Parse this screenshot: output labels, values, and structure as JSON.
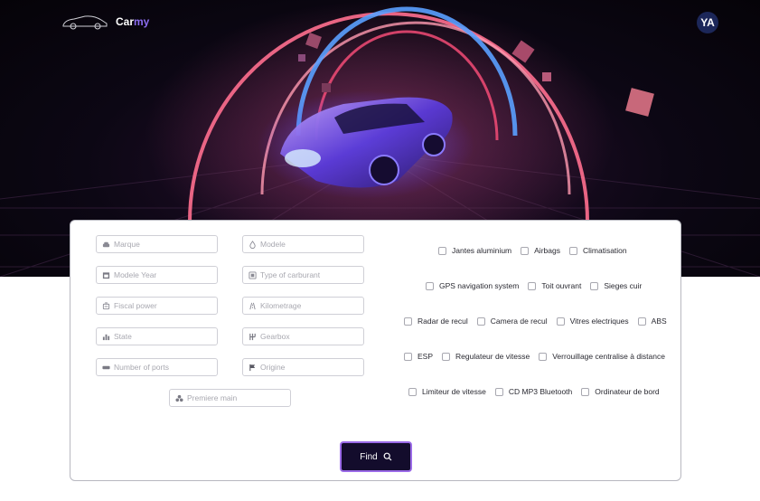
{
  "brand": {
    "name_main": "Car",
    "name_accent": "my"
  },
  "user": {
    "initials": "YA"
  },
  "colors": {
    "accent": "#8b6cf0",
    "button_bg": "#130c2c",
    "button_border": "#9b6be8",
    "avatar_bg": "#1c2759"
  },
  "hero": {
    "image": "neon-sports-car-illustration"
  },
  "search": {
    "fields": [
      {
        "placeholder": "Marque",
        "icon": "car-icon"
      },
      {
        "placeholder": "Modele",
        "icon": "drop-icon"
      },
      {
        "placeholder": "Modele Year",
        "icon": "calendar-icon"
      },
      {
        "placeholder": "Type of carburant",
        "icon": "fuel-icon"
      },
      {
        "placeholder": "Fiscal power",
        "icon": "engine-icon"
      },
      {
        "placeholder": "Kilometrage",
        "icon": "road-icon"
      },
      {
        "placeholder": "State",
        "icon": "bars-icon"
      },
      {
        "placeholder": "Gearbox",
        "icon": "gearbox-icon"
      },
      {
        "placeholder": "Number of ports",
        "icon": "door-icon"
      },
      {
        "placeholder": "Origine",
        "icon": "flag-icon"
      },
      {
        "placeholder": "Premiere main",
        "icon": "users-icon"
      }
    ],
    "options": [
      "Jantes aluminium",
      "Airbags",
      "Climatisation",
      "GPS navigation system",
      "Toit ouvrant",
      "Sieges cuir",
      "Radar de recul",
      "Camera de recul",
      "Vitres electriques",
      "ABS",
      "ESP",
      "Regulateur de vitesse",
      "Verrouillage centralise à distance",
      "Limiteur de vitesse",
      "CD MP3 Bluetooth",
      "Ordinateur de bord"
    ],
    "find_label": "Find"
  }
}
